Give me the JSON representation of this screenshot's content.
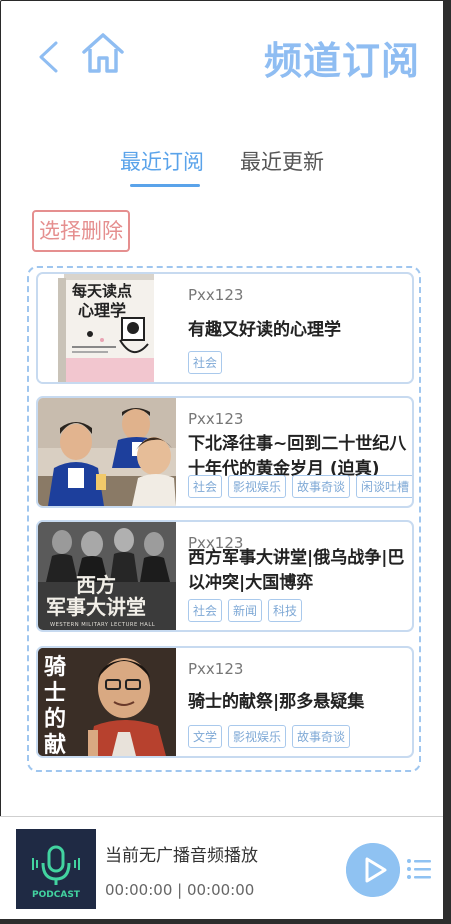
{
  "header": {
    "title": "频道订阅"
  },
  "tabs": [
    {
      "label": "最近订阅",
      "active": true
    },
    {
      "label": "最近更新",
      "active": false
    }
  ],
  "actions": {
    "delete_label": "选择删除"
  },
  "channels": [
    {
      "author": "Pxx123",
      "title": "有趣又好读的心理学",
      "tags": [
        "社会"
      ],
      "cover_text": "每天读点心理学"
    },
    {
      "author": "Pxx123",
      "title": "下北泽往事~回到二十世纪八十年代的黄金岁月 (迫真)",
      "tags": [
        "社会",
        "影视娱乐",
        "故事奇谈",
        "闲谈吐槽"
      ]
    },
    {
      "author": "Pxx123",
      "title": "西方军事大讲堂|俄乌战争|巴以冲突|大国博弈",
      "tags": [
        "社会",
        "新闻",
        "科技"
      ],
      "cover_text": "西方军事大讲堂",
      "cover_subtext": "WESTERN MILITARY LECTURE HALL"
    },
    {
      "author": "Pxx123",
      "title": "骑士的献祭|那多悬疑集",
      "tags": [
        "文学",
        "影视娱乐",
        "故事奇谈"
      ],
      "cover_text": "骑士的献祭"
    }
  ],
  "player": {
    "now_playing": "当前无广播音频播放",
    "time": "00:00:00 | 00:00:00",
    "cover_text": "PODCAST"
  },
  "colors": {
    "accent": "#8fbdf2",
    "tab_active": "#5aa3ea",
    "delete": "#e58f8f",
    "tag": "#7fa9d6"
  }
}
